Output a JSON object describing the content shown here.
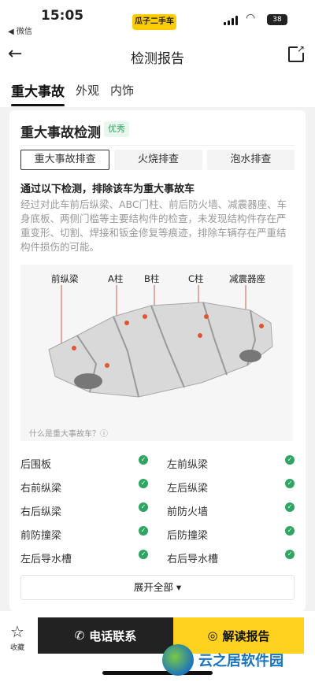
{
  "status": {
    "time": "15:05",
    "back_app": "◀ 微信",
    "brand": "瓜子二手车",
    "battery": "38"
  },
  "header": {
    "title": "检测报告"
  },
  "tabs": [
    "重大事故",
    "外观",
    "内饰"
  ],
  "card": {
    "title": "重大事故检测",
    "badge": "优秀",
    "segments": [
      "重大事故排查",
      "火烧排查",
      "泡水排查"
    ],
    "subhead": "通过以下检测，排除该车为重大事故车",
    "description": "经过对此车前后纵梁、ABC门柱、前后防火墙、减震器座、车身底板、两侧门槛等主要结构件的检查，未发现结构件存在严重变形、切割、焊接和钣金修复等痕迹，排除车辆存在严重结构件损伤的可能。",
    "diagram_labels": [
      "前纵梁",
      "A柱",
      "B柱",
      "C柱",
      "减震器座"
    ],
    "diagram_question": "什么是重大事故车？ⓘ",
    "checks": [
      [
        "后围板",
        "左前纵梁"
      ],
      [
        "右前纵梁",
        "左后纵梁"
      ],
      [
        "右后纵梁",
        "前防火墙"
      ],
      [
        "前防撞梁",
        "后防撞梁"
      ],
      [
        "左后导水槽",
        "右后导水槽"
      ]
    ],
    "expand": "展开全部 ▾"
  },
  "bottom": {
    "fav": "收藏",
    "call": "电话联系",
    "unlock": "解读报告"
  },
  "watermark": "云之居软件园",
  "colors": {
    "accent": "#ffd21f",
    "ok": "#2fa463",
    "dark": "#222222"
  }
}
